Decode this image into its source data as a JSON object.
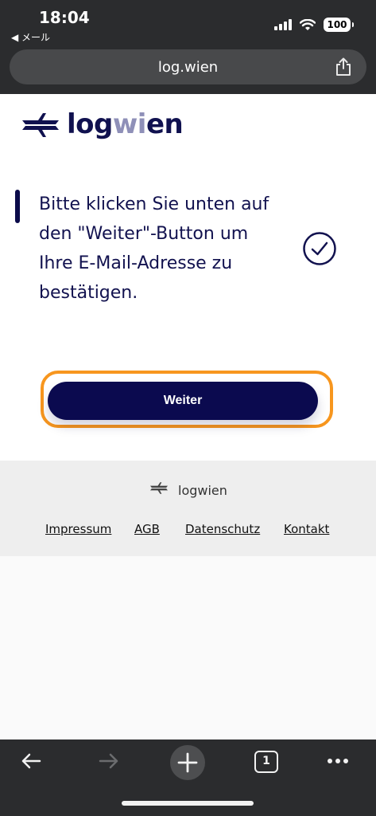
{
  "status_bar": {
    "time": "18:04",
    "back_app": "◀ メール",
    "battery": "100",
    "icons": [
      "signal-icon",
      "wifi-icon",
      "battery-icon"
    ]
  },
  "browser": {
    "url": "log.wien",
    "share_icon": "share-icon",
    "toolbar_icons": [
      "back-arrow-icon",
      "forward-arrow-icon",
      "new-tab-plus-icon",
      "tabs-count-icon",
      "more-dots-icon"
    ],
    "tab_count": "1"
  },
  "header": {
    "logo_text_prefix": "log",
    "logo_text_accent": "wi",
    "logo_text_suffix": "en"
  },
  "main": {
    "message": "Bitte klicken Sie unten auf den \"Weiter\"-Button um Ihre E-Mail-Adresse zu bestätigen.",
    "check_icon": "check-circle-icon",
    "continue_button": "Weiter"
  },
  "footer": {
    "logo_text": "logwien",
    "links": [
      "Impressum",
      "AGB",
      "Datenschutz",
      "Kontakt"
    ]
  },
  "colors": {
    "brand_navy": "#0b0a4f",
    "highlight_orange": "#f7961e",
    "chrome_dark": "#2b2c2e"
  }
}
